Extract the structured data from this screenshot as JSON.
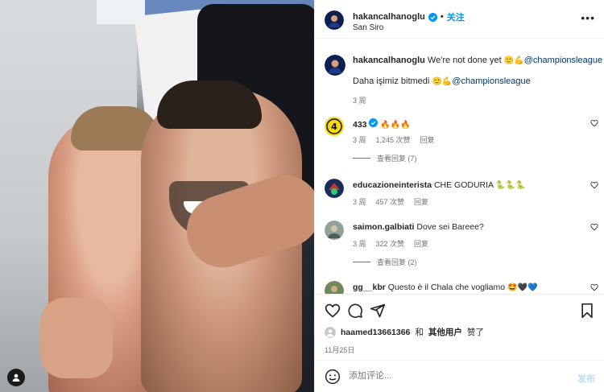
{
  "post": {
    "username": "hakancalhanoglu",
    "follow_label": "关注",
    "dot": "•",
    "location": "San Siro",
    "more": "•••"
  },
  "caption": {
    "username": "hakancalhanoglu",
    "line1": "We're not done yet",
    "line1_emojis": "🙂💪",
    "line1_mention": "@championsleague",
    "line2": "Daha işimiz bitmedi",
    "line2_emojis": "🙂💪",
    "line2_mention": "@championsleague",
    "time": "3 周"
  },
  "comments": [
    {
      "username": "433",
      "verified": true,
      "text": "",
      "emojis": "🔥🔥🔥",
      "time": "3 周",
      "likes": "1,245 次赞",
      "reply": "回复",
      "replies": "查看回复 (7)"
    },
    {
      "username": "educazioneinteristа",
      "text": "CHE GODURIA",
      "emojis": "🐍🐍🐍",
      "time": "3 周",
      "likes": "457 次赞",
      "reply": "回复",
      "replies": ""
    },
    {
      "username": "saimon.galbiati",
      "text": "Dove sei Bareee?",
      "emojis": "",
      "time": "3 周",
      "likes": "322 次赞",
      "reply": "回复",
      "replies": "查看回复 (2)"
    },
    {
      "username": "gg__kbr",
      "text": "Questo è il Chala che vogliamo",
      "emojis": "🤩🖤💙",
      "time": "",
      "likes": "",
      "reply": "",
      "replies": ""
    }
  ],
  "likes": {
    "user": "haamed13661366",
    "and": "和",
    "others": "其他用户",
    "liked": "赞了"
  },
  "date": "11月25日",
  "add_comment": {
    "placeholder": "添加评论...",
    "post_label": "发布"
  },
  "icons": {
    "like": "heart-icon",
    "comment": "comment-icon",
    "share": "share-icon",
    "save": "bookmark-icon",
    "emoji": "smile-icon"
  },
  "colors": {
    "accent": "#0095f6",
    "mention": "#00376b",
    "muted": "#737373"
  }
}
